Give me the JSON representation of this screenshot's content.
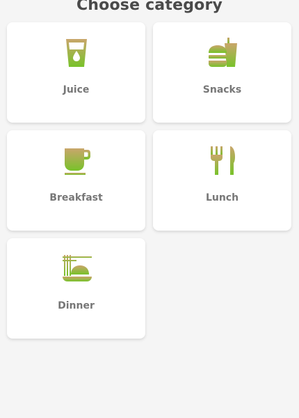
{
  "header": {
    "title": "Choose category"
  },
  "colors": {
    "icon_top": "#c7a86a",
    "icon_bottom": "#7cc22a",
    "label": "#777777",
    "background": "#f5f5f5",
    "card": "#ffffff"
  },
  "categories": [
    {
      "label": "Juice",
      "icon": "juice-glass-icon"
    },
    {
      "label": "Snacks",
      "icon": "burger-drink-icon"
    },
    {
      "label": "Breakfast",
      "icon": "coffee-cup-icon"
    },
    {
      "label": "Lunch",
      "icon": "fork-knife-icon"
    },
    {
      "label": "Dinner",
      "icon": "noodle-bowl-icon"
    }
  ]
}
